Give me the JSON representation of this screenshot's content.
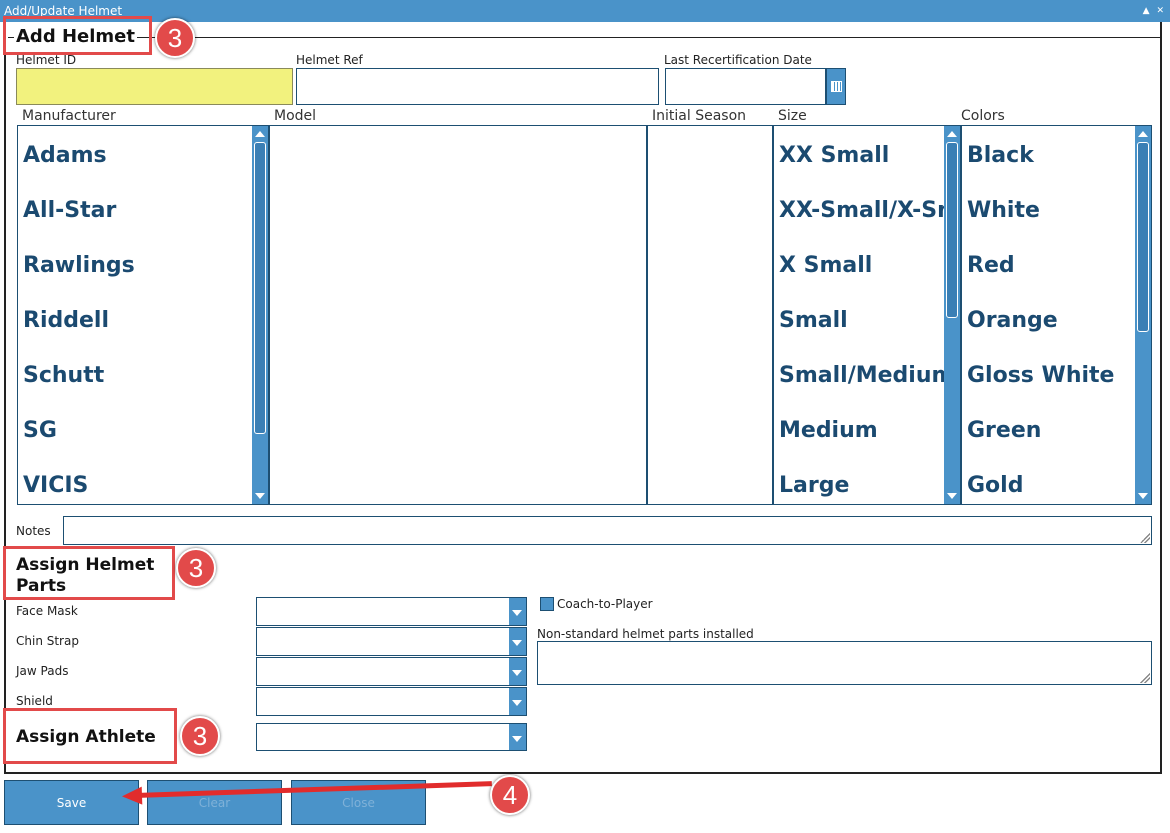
{
  "window": {
    "title": "Add/Update Helmet",
    "controls": "▲ ✕"
  },
  "sections": {
    "add_helmet": "Add Helmet",
    "assign_parts": "Assign Helmet Parts",
    "assign_athlete": "Assign Athlete"
  },
  "fields": {
    "helmet_id": {
      "label": "Helmet ID",
      "value": ""
    },
    "helmet_ref": {
      "label": "Helmet Ref",
      "value": ""
    },
    "last_recert": {
      "label": "Last Recertification Date",
      "value": ""
    },
    "notes": {
      "label": "Notes",
      "value": ""
    }
  },
  "lists": {
    "manufacturer": {
      "label": "Manufacturer",
      "items": [
        "Adams",
        "All-Star",
        "Rawlings",
        "Riddell",
        "Schutt",
        "SG",
        "VICIS"
      ]
    },
    "model": {
      "label": "Model",
      "items": []
    },
    "initial_season": {
      "label": "Initial Season",
      "items": []
    },
    "size": {
      "label": "Size",
      "items": [
        "XX Small",
        "XX-Small/X-Small",
        "X Small",
        "Small",
        "Small/Medium",
        "Medium",
        "Large"
      ]
    },
    "colors": {
      "label": "Colors",
      "items": [
        "Black",
        "White",
        "Red",
        "Orange",
        "Gloss White",
        "Green",
        "Gold"
      ]
    }
  },
  "parts": {
    "face_mask": {
      "label": "Face Mask",
      "value": ""
    },
    "chin_strap": {
      "label": "Chin Strap",
      "value": ""
    },
    "jaw_pads": {
      "label": "Jaw Pads",
      "value": ""
    },
    "shield": {
      "label": "Shield",
      "value": ""
    },
    "coach_to_player": {
      "label": "Coach-to-Player",
      "checked": true
    },
    "non_standard": {
      "label": "Non-standard helmet parts installed",
      "value": ""
    }
  },
  "athlete": {
    "value": ""
  },
  "buttons": {
    "save": "Save",
    "clear": "Clear",
    "close": "Close"
  },
  "callouts": {
    "c1": "3",
    "c2": "3",
    "c3": "3",
    "c4": "4"
  },
  "colors": {
    "accent": "#4a93c9",
    "callout": "#e24a4a",
    "highlight_input": "#f2f27e",
    "list_text": "#1b4a70"
  }
}
